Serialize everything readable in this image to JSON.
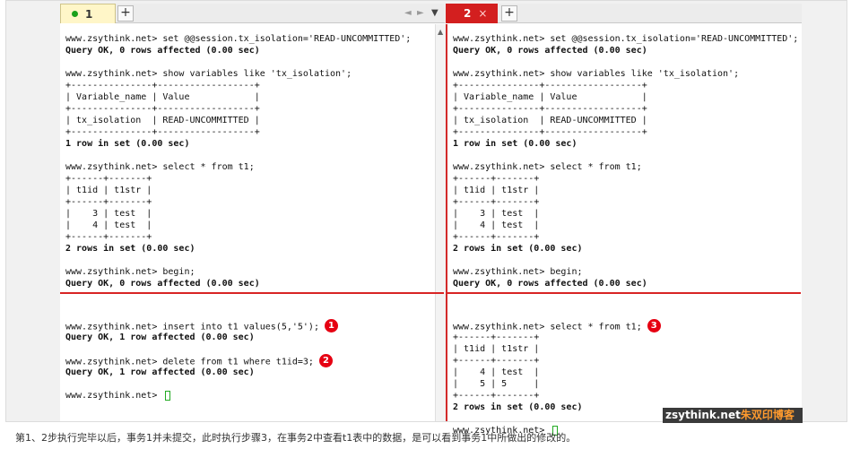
{
  "window1": {
    "tab_label": "1",
    "add_tab_label": "+",
    "nav_left": "◄",
    "nav_right": "►",
    "nav_menu": "▼",
    "top_lines": [
      {
        "text": "www.zsythink.net> set @@session.tx_isolation='READ-UNCOMMITTED';",
        "bold": false
      },
      {
        "text": "Query OK, 0 rows affected (0.00 sec)",
        "bold": true
      },
      {
        "text": "",
        "bold": false
      },
      {
        "text": "www.zsythink.net> show variables like 'tx_isolation';",
        "bold": false
      },
      {
        "text": "+---------------+------------------+",
        "bold": false
      },
      {
        "text": "| Variable_name | Value            |",
        "bold": false
      },
      {
        "text": "+---------------+------------------+",
        "bold": false
      },
      {
        "text": "| tx_isolation  | READ-UNCOMMITTED |",
        "bold": false
      },
      {
        "text": "+---------------+------------------+",
        "bold": false
      },
      {
        "text": "1 row in set (0.00 sec)",
        "bold": true
      },
      {
        "text": "",
        "bold": false
      },
      {
        "text": "www.zsythink.net> select * from t1;",
        "bold": false
      },
      {
        "text": "+------+-------+",
        "bold": false
      },
      {
        "text": "| t1id | t1str |",
        "bold": false
      },
      {
        "text": "+------+-------+",
        "bold": false
      },
      {
        "text": "|    3 | test  |",
        "bold": false
      },
      {
        "text": "|    4 | test  |",
        "bold": false
      },
      {
        "text": "+------+-------+",
        "bold": false
      },
      {
        "text": "2 rows in set (0.00 sec)",
        "bold": true
      },
      {
        "text": "",
        "bold": false
      },
      {
        "text": "www.zsythink.net> begin;",
        "bold": false
      },
      {
        "text": "Query OK, 0 rows affected (0.00 sec)",
        "bold": true
      }
    ],
    "bottom_lines": [
      {
        "text": "www.zsythink.net> insert into t1 values(5,'5');",
        "bold": false,
        "step": "1"
      },
      {
        "text": "Query OK, 1 row affected (0.00 sec)",
        "bold": true
      },
      {
        "text": "",
        "bold": false
      },
      {
        "text": "www.zsythink.net> delete from t1 where t1id=3;",
        "bold": false,
        "step": "2"
      },
      {
        "text": "Query OK, 1 row affected (0.00 sec)",
        "bold": true
      },
      {
        "text": "",
        "bold": false
      },
      {
        "text": "www.zsythink.net> ",
        "bold": false,
        "cursor": true
      }
    ]
  },
  "window2": {
    "tab_label": "2",
    "close_label": "×",
    "add_tab_label": "+",
    "top_lines": [
      {
        "text": "www.zsythink.net> set @@session.tx_isolation='READ-UNCOMMITTED';",
        "bold": false
      },
      {
        "text": "Query OK, 0 rows affected (0.00 sec)",
        "bold": true
      },
      {
        "text": "",
        "bold": false
      },
      {
        "text": "www.zsythink.net> show variables like 'tx_isolation';",
        "bold": false
      },
      {
        "text": "+---------------+------------------+",
        "bold": false
      },
      {
        "text": "| Variable_name | Value            |",
        "bold": false
      },
      {
        "text": "+---------------+------------------+",
        "bold": false
      },
      {
        "text": "| tx_isolation  | READ-UNCOMMITTED |",
        "bold": false
      },
      {
        "text": "+---------------+------------------+",
        "bold": false
      },
      {
        "text": "1 row in set (0.00 sec)",
        "bold": true
      },
      {
        "text": "",
        "bold": false
      },
      {
        "text": "www.zsythink.net> select * from t1;",
        "bold": false
      },
      {
        "text": "+------+-------+",
        "bold": false
      },
      {
        "text": "| t1id | t1str |",
        "bold": false
      },
      {
        "text": "+------+-------+",
        "bold": false
      },
      {
        "text": "|    3 | test  |",
        "bold": false
      },
      {
        "text": "|    4 | test  |",
        "bold": false
      },
      {
        "text": "+------+-------+",
        "bold": false
      },
      {
        "text": "2 rows in set (0.00 sec)",
        "bold": true
      },
      {
        "text": "",
        "bold": false
      },
      {
        "text": "www.zsythink.net> begin;",
        "bold": false
      },
      {
        "text": "Query OK, 0 rows affected (0.00 sec)",
        "bold": true
      }
    ],
    "bottom_lines": [
      {
        "text": "www.zsythink.net> select * from t1;",
        "bold": false,
        "step": "3"
      },
      {
        "text": "+------+-------+",
        "bold": false
      },
      {
        "text": "| t1id | t1str |",
        "bold": false
      },
      {
        "text": "+------+-------+",
        "bold": false
      },
      {
        "text": "|    4 | test  |",
        "bold": false
      },
      {
        "text": "|    5 | 5     |",
        "bold": false
      },
      {
        "text": "+------+-------+",
        "bold": false
      },
      {
        "text": "2 rows in set (0.00 sec)",
        "bold": true
      },
      {
        "text": "",
        "bold": false
      },
      {
        "text": "www.zsythink.net> ",
        "bold": false,
        "cursor": true
      }
    ]
  },
  "watermark": {
    "main": "zsythink.net",
    "suffix": "朱双印博客"
  },
  "caption": "第1、2步执行完毕以后，事务1并未提交，此时执行步骤3，在事务2中查看t1表中的数据，是可以看到事务1中所做出的修改的。",
  "colors": {
    "divider": "#d82424",
    "step_badge": "#e60012",
    "tab2_active": "#d31f1f",
    "tab1_bg": "#fff6c8"
  },
  "icons": {
    "tab_status": "status-dot-icon",
    "cursor": "block-cursor-icon"
  }
}
